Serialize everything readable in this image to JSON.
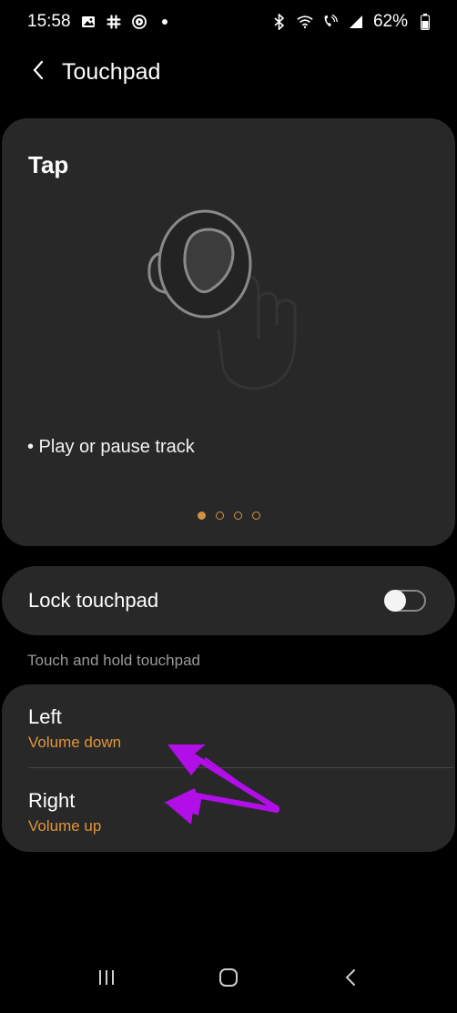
{
  "status_bar": {
    "time": "15:58",
    "battery": "62%",
    "left_icons": [
      "gallery-icon",
      "slack-icon",
      "media-icon",
      "notification-dot-icon"
    ],
    "right_icons": [
      "bluetooth-icon",
      "wifi-icon",
      "call-signal-icon",
      "signal-icon",
      "battery-icon"
    ]
  },
  "app_bar": {
    "title": "Touchpad",
    "back_icon": "back-chevron-icon"
  },
  "tap_card": {
    "title": "Tap",
    "illustration": "earbud-icon",
    "description": "• Play or pause track",
    "pager": {
      "count": 4,
      "active_index": 0
    }
  },
  "lock_touchpad": {
    "label": "Lock touchpad",
    "enabled": false
  },
  "section_header": "Touch and hold touchpad",
  "touch_and_hold": [
    {
      "title": "Left",
      "value": "Volume down"
    },
    {
      "title": "Right",
      "value": "Volume up"
    }
  ],
  "annotations": {
    "arrow_color": "#b10ee8"
  },
  "colors": {
    "accent": "#e0953a",
    "card_bg": "#282828",
    "background": "#000000"
  },
  "nav_bar": {
    "buttons": [
      "recent-apps-icon",
      "home-icon",
      "back-icon"
    ]
  }
}
